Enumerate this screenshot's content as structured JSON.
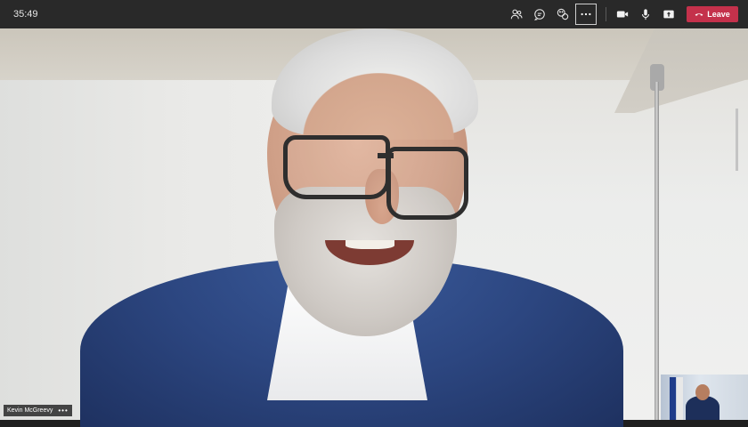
{
  "toolbar": {
    "timer": "35:49",
    "icons": {
      "participants": "people-icon",
      "chat": "chat-icon",
      "reactions": "reactions-icon",
      "more": "more-icon",
      "camera": "camera-icon",
      "mic": "mic-icon",
      "share": "share-icon",
      "leave": "phone-hangup-icon"
    },
    "leave_label": "Leave",
    "leave_color": "#c4314b"
  },
  "video": {
    "participant_name": "Kevin McGreevy",
    "name_menu": "•••"
  }
}
